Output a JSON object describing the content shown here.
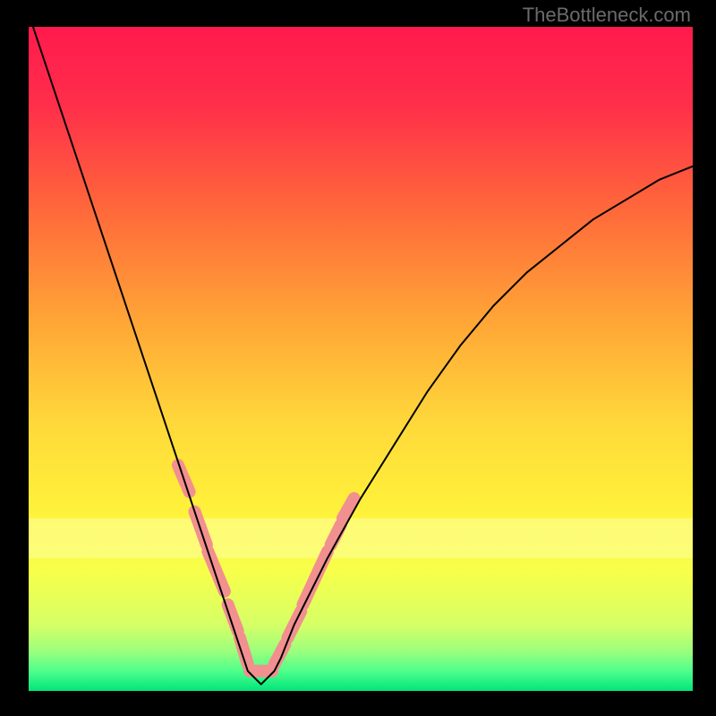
{
  "watermark": "TheBottleneck.com",
  "chart_data": {
    "type": "line",
    "title": "",
    "xlabel": "",
    "ylabel": "",
    "xlim": [
      0,
      100
    ],
    "ylim": [
      0,
      100
    ],
    "background_gradient": {
      "stops": [
        {
          "offset": 0.0,
          "color": "#ff1a4d"
        },
        {
          "offset": 0.12,
          "color": "#ff2f4a"
        },
        {
          "offset": 0.28,
          "color": "#ff6a3a"
        },
        {
          "offset": 0.45,
          "color": "#ffa836"
        },
        {
          "offset": 0.6,
          "color": "#ffd93a"
        },
        {
          "offset": 0.72,
          "color": "#fff03a"
        },
        {
          "offset": 0.82,
          "color": "#f7ff4a"
        },
        {
          "offset": 0.9,
          "color": "#d6ff66"
        },
        {
          "offset": 0.94,
          "color": "#9cff7c"
        },
        {
          "offset": 0.97,
          "color": "#4fff8c"
        },
        {
          "offset": 1.0,
          "color": "#00e57a"
        }
      ]
    },
    "series": [
      {
        "name": "bottleneck-curve",
        "color": "#000000",
        "stroke_width_px": 2,
        "x": [
          0,
          2,
          4,
          6,
          8,
          10,
          12,
          14,
          16,
          18,
          20,
          22,
          24,
          26,
          28,
          30,
          32,
          33,
          34,
          35,
          36,
          37,
          38,
          40,
          42,
          45,
          50,
          55,
          60,
          65,
          70,
          75,
          80,
          85,
          90,
          95,
          100
        ],
        "y": [
          102,
          96,
          90,
          84,
          78,
          72,
          66,
          60,
          54,
          48,
          42,
          36,
          30,
          24,
          18,
          12,
          6,
          3,
          2,
          1,
          2,
          3,
          5,
          10,
          14,
          20,
          29,
          37,
          45,
          52,
          58,
          63,
          67,
          71,
          74,
          77,
          79
        ]
      }
    ],
    "segments": [
      {
        "name": "pink-segments",
        "color": "#f28f8f",
        "stroke_width_px": 14,
        "pieces": [
          {
            "x": [
              22.5,
              24.2
            ],
            "y": [
              34,
              30
            ]
          },
          {
            "x": [
              25.0,
              26.8
            ],
            "y": [
              27,
              22
            ]
          },
          {
            "x": [
              27.0,
              29.5
            ],
            "y": [
              21,
              15
            ]
          },
          {
            "x": [
              30.0,
              31.5
            ],
            "y": [
              13,
              9
            ]
          },
          {
            "x": [
              31.8,
              33.0
            ],
            "y": [
              8,
              4
            ]
          },
          {
            "x": [
              33.3,
              36.7
            ],
            "y": [
              3,
              3
            ]
          },
          {
            "x": [
              37.0,
              38.6
            ],
            "y": [
              4,
              7
            ]
          },
          {
            "x": [
              39.0,
              41.0
            ],
            "y": [
              8,
              12
            ]
          },
          {
            "x": [
              41.3,
              45.0
            ],
            "y": [
              13,
              21
            ]
          },
          {
            "x": [
              45.5,
              47.0
            ],
            "y": [
              22,
              25
            ]
          },
          {
            "x": [
              47.3,
              49.0
            ],
            "y": [
              26,
              29
            ]
          }
        ]
      }
    ],
    "pale_band": {
      "y_from": 74,
      "y_to": 80,
      "color": "#ffffa0",
      "opacity": 0.55
    }
  }
}
